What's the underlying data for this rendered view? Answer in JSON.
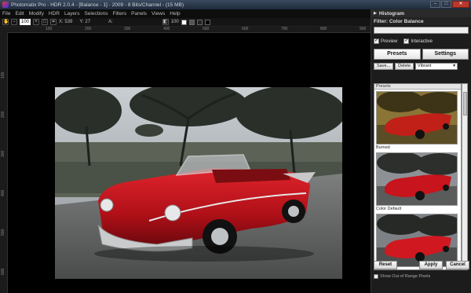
{
  "window": {
    "title": "Photomatix Pro - HDR 2.0.4 - [Balance - 1] - 2009 - 8 Bits/Channel - (15 MB)",
    "minimize": "–",
    "maximize": "□",
    "close": "✕"
  },
  "menu": [
    "File",
    "Edit",
    "Modify",
    "HDR",
    "Layers",
    "Selections",
    "Filters",
    "Panels",
    "Views",
    "Help"
  ],
  "toolbar": {
    "zoom_value": "100",
    "x_readout": "X: 539",
    "y_readout": "Y: 27",
    "a_label": "A:",
    "pct_value": "100"
  },
  "ruler_top": [
    "100",
    "200",
    "300",
    "400",
    "500",
    "600",
    "700",
    "800",
    "900"
  ],
  "ruler_left": [
    "100",
    "200",
    "300",
    "400",
    "500",
    "600"
  ],
  "panel": {
    "histogram_label": "Histogram",
    "filter_title": "Filter: Color Balance",
    "preview_label": "Preview",
    "interactive_label": "Interactive",
    "tab_presets": "Presets",
    "tab_settings": "Settings",
    "save_label": "Save...",
    "delete_label": "Delete",
    "preset_select": "Vibrant",
    "presets_header": "Presets",
    "thumbs": [
      {
        "label": "Burned"
      },
      {
        "label": "Color Default"
      },
      {
        "label": ""
      }
    ],
    "reset_label": "Reset",
    "apply_label": "Apply",
    "cancel_label": "Cancel",
    "out_of_range_label": "Show Out of Range Pixels"
  },
  "colors": {
    "car_red": "#c4121c",
    "panel_bg": "#1c1c1c",
    "canvas_bg": "#000000"
  }
}
